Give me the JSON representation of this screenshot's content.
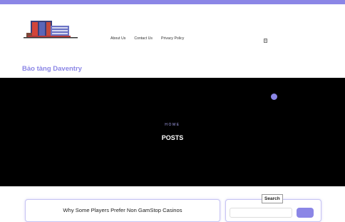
{
  "site": {
    "title": "Bảo tàng Daventry"
  },
  "nav": {
    "items": [
      "About Us",
      "Contact Us",
      "Privacy Policy"
    ]
  },
  "hero": {
    "breadcrumb": "HOME",
    "title": "POSTS"
  },
  "post": {
    "title": "Why Some Players Prefer Non GamStop Casinos"
  },
  "sidebar": {
    "search_title": "Search",
    "search_placeholder": ""
  },
  "colors": {
    "accent": "#8b86e6",
    "hero_bg": "#000000"
  },
  "icons": {
    "menu": "search-icon"
  }
}
